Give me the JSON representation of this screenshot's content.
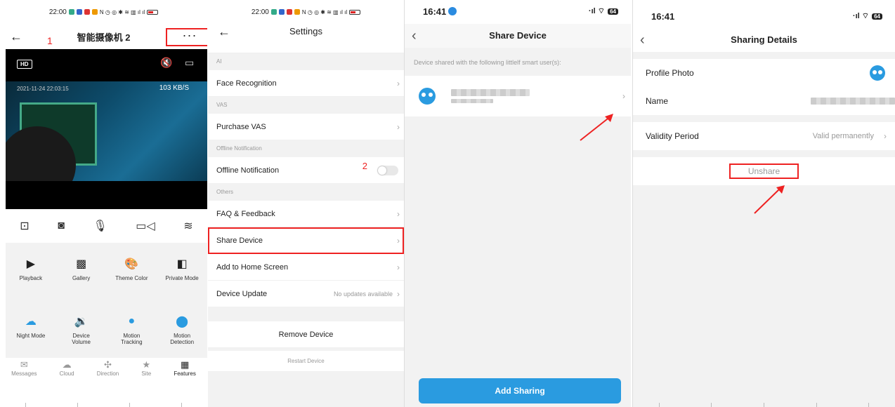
{
  "panel1": {
    "status_time": "22:00",
    "title": "智能摄像机 2",
    "more_label": "···",
    "step_label": "1",
    "hd_label": "HD",
    "timestamp": "2021-11-24 22:03:15",
    "bitrate": "103 KB/S",
    "features": [
      {
        "icon": "playback-icon",
        "label": "Playback"
      },
      {
        "icon": "gallery-icon",
        "label": "Gallery"
      },
      {
        "icon": "palette-icon",
        "label": "Theme Color"
      },
      {
        "icon": "private-mode-icon",
        "label": "Private Mode"
      },
      {
        "icon": "night-mode-icon",
        "label": "Night Mode"
      },
      {
        "icon": "volume-icon",
        "label": "Device Volume"
      },
      {
        "icon": "location-icon",
        "label": "Motion Tracking"
      },
      {
        "icon": "running-person-icon",
        "label": "Motion Detection"
      }
    ],
    "tabs": [
      {
        "icon": "messages-icon",
        "label": "Messages"
      },
      {
        "icon": "cloud-icon",
        "label": "Cloud"
      },
      {
        "icon": "direction-icon",
        "label": "Direction"
      },
      {
        "icon": "star-icon",
        "label": "Site"
      },
      {
        "icon": "features-grid-icon",
        "label": "Features"
      }
    ]
  },
  "panel2": {
    "status_time": "22:00",
    "title": "Settings",
    "sections": {
      "ai": "AI",
      "vas": "VAS",
      "offline": "Offline Notification",
      "others": "Others"
    },
    "rows": {
      "face": "Face Recognition",
      "purchase": "Purchase VAS",
      "offline": "Offline Notification",
      "faq": "FAQ & Feedback",
      "share": "Share Device",
      "home": "Add to Home Screen",
      "update": "Device Update",
      "update_value": "No updates available"
    },
    "step_label": "2",
    "remove": "Remove Device",
    "restart": "Restart Device"
  },
  "panel3": {
    "status_time": "16:41",
    "battery": "64",
    "title": "Share Device",
    "note": "Device shared with the following littlelf smart user(s):",
    "add_button": "Add Sharing"
  },
  "panel4": {
    "status_time": "16:41",
    "battery": "64",
    "title": "Sharing Details",
    "profile_label": "Profile Photo",
    "name_label": "Name",
    "validity_label": "Validity Period",
    "validity_value": "Valid permanently",
    "unshare": "Unshare"
  },
  "colors": {
    "accent": "#2a9be0",
    "highlight": "#e22222"
  }
}
